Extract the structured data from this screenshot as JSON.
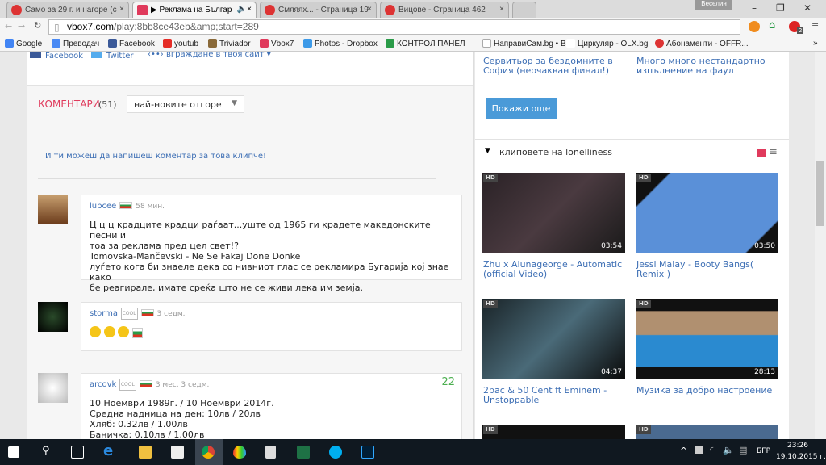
{
  "browser": {
    "tabs": [
      {
        "label": "Само за 29 г. и нагоре (с"
      },
      {
        "label": "▶ Реклама на Българ"
      },
      {
        "label": "Смяяях... - Страница 19"
      },
      {
        "label": "Вицове - Страница 462"
      }
    ],
    "user": "Веселин",
    "url_host": "vbox7.com",
    "url_path": "/play:8bb8ce43eb&amp;start=289",
    "bookmarks": [
      "Google",
      "Преводач",
      "Facebook",
      "youtub",
      "Triviador",
      "Vbox7",
      "Photos - Dropbox",
      "КОНТРОЛ ПАНЕЛ",
      "НаправиСам.bg • В...",
      "Циркуляр - OLX.bg",
      "Абонаменти - OFFR..."
    ],
    "badge": "2"
  },
  "share": {
    "facebook": "Facebook",
    "twitter": "Twitter",
    "embed": "вграждане в твоя сайт"
  },
  "comments": {
    "title": "КОМЕНТАРИ",
    "count": "(51)",
    "sort": "най-новите отгоре",
    "write_prompt": "И ти можеш да напишеш коментар за това клипче!",
    "items": [
      {
        "user": "lupcee",
        "time": "58 мин.",
        "lines": [
          "Ц ц ц крадците крадци раѓаат...уште од 1965 ги крадете македонските песни и",
          "тоа за реклама пред цел свет!?",
          "Tomovska-Mančevski - Ne Se Fakaj Done Donke",
          "луѓето кога би знаеле дека со нивниот глас се рекламира Бугарија кој знае како",
          "бе реагирале, имате среќа што не се живи лека им земја."
        ]
      },
      {
        "user": "storma",
        "cool": "COOL",
        "time": "3 седм."
      },
      {
        "user": "arcovk",
        "cool": "COOL",
        "time": "3 мес. 3 седм.",
        "score": "22",
        "lines": [
          "10 Ноември 1989г. / 10 Ноември 2014г.",
          "Средна надница на ден: 10лв / 20лв",
          "Хляб: 0.32лв / 1.00лв",
          "Баничка: 0.10лв / 1.00лв"
        ]
      }
    ]
  },
  "sidebar": {
    "prev_titles": [
      "Сервитьор за бездомните в София (неочакван финал!)",
      "Много много нестандартно изпълнение на фаул"
    ],
    "show_more": "Покажи още",
    "section_title": "клиповете на lonelliness",
    "videos": [
      {
        "title": "Zhu x Alunageorge - Automatic (official Video)",
        "duration": "03:54",
        "hd": "HD"
      },
      {
        "title": "Jessi Malay - Booty Bangs( Remix )",
        "duration": "03:50",
        "hd": "HD"
      },
      {
        "title": "2pac & 50 Cent ft Eminem - Unstoppable",
        "duration": "04:37",
        "hd": "HD"
      },
      {
        "title": "Музика за добро настроение",
        "duration": "28:13",
        "hd": "HD"
      },
      {
        "hd": "HD"
      },
      {
        "hd": "HD"
      }
    ]
  },
  "taskbar": {
    "lang": "БГР",
    "time": "23:26",
    "date": "19.10.2015 г."
  }
}
